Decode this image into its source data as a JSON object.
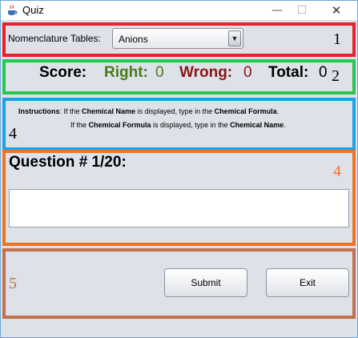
{
  "window": {
    "title": "Quiz",
    "minimize": "—",
    "maximize": "☐",
    "close": "✕"
  },
  "annotations": [
    "1",
    "2",
    "4",
    "4",
    "5"
  ],
  "nomenclature": {
    "label": "Nomenclature Tables:",
    "selected": "Anions"
  },
  "score": {
    "label": "Score:",
    "right_label": "Right:",
    "right_value": "0",
    "wrong_label": "Wrong:",
    "wrong_value": "0",
    "total_label": "Total:",
    "total_value": "0"
  },
  "instructions": {
    "line1": {
      "lead": "Instructions",
      "t1": ": If the ",
      "b1": "Chemical Name",
      "t2": " is displayed, type in the ",
      "b2": "Chemical Formula",
      "t3": "."
    },
    "line2": {
      "t1": "If the ",
      "b1": "Chemical Formula",
      "t2": " is displayed, type in the ",
      "b2": "Chemical Name",
      "t3": "."
    }
  },
  "question": {
    "title": "Question # 1/20:",
    "answer_value": ""
  },
  "buttons": {
    "submit": "Submit",
    "exit": "Exit"
  },
  "colors": {
    "right": "#4a7a1c",
    "wrong": "#8b1616",
    "box1": "#e8212b",
    "box2": "#2dc450",
    "box3": "#1ca0e8",
    "box4": "#ee7424",
    "box5": "#c1714e"
  }
}
